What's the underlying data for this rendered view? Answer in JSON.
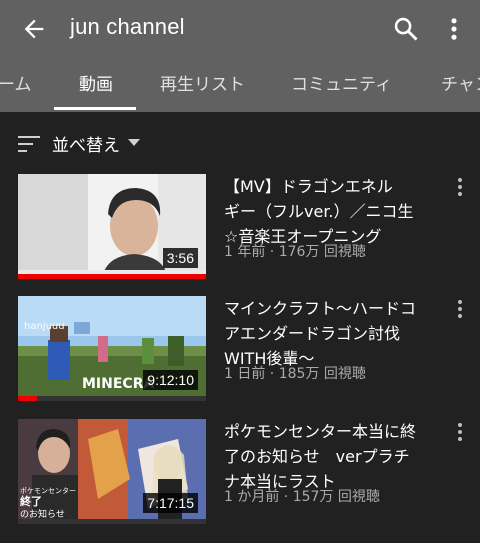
{
  "header": {
    "title": "jun channel"
  },
  "tabs": [
    {
      "label": "ーム"
    },
    {
      "label": "動画"
    },
    {
      "label": "再生リスト"
    },
    {
      "label": "コミュニティ"
    },
    {
      "label": "チャン"
    }
  ],
  "sort": {
    "label": "並べ替え"
  },
  "videos": [
    {
      "title_lines": [
        "【MV】ドラゴンエネル",
        "ギー（フルver.）／ニコ生",
        "☆音楽王オープニング"
      ],
      "meta": "1 年前 · 176万 回視聴",
      "duration": "3:56",
      "progress": 1.0
    },
    {
      "title_lines": [
        "マインクラフト〜ハードコ",
        "アエンダードラゴン討伐",
        "WITH後輩〜"
      ],
      "meta": "1 日前 · 185万 回視聴",
      "duration": "9:12:10",
      "progress": 0.1,
      "thumb_texts": [
        "hanjuuu",
        "MINECRA"
      ]
    },
    {
      "title_lines": [
        "ポケモンセンター本当に終",
        "了のお知らせ　verプラチ",
        "ナ本当にラスト"
      ],
      "meta": "1 か月前 · 157万 回視聴",
      "duration": "7:17:15",
      "progress": 0.0,
      "thumb_texts": [
        "ポケモンセンター",
        "終了",
        "のお知らせ"
      ]
    }
  ]
}
